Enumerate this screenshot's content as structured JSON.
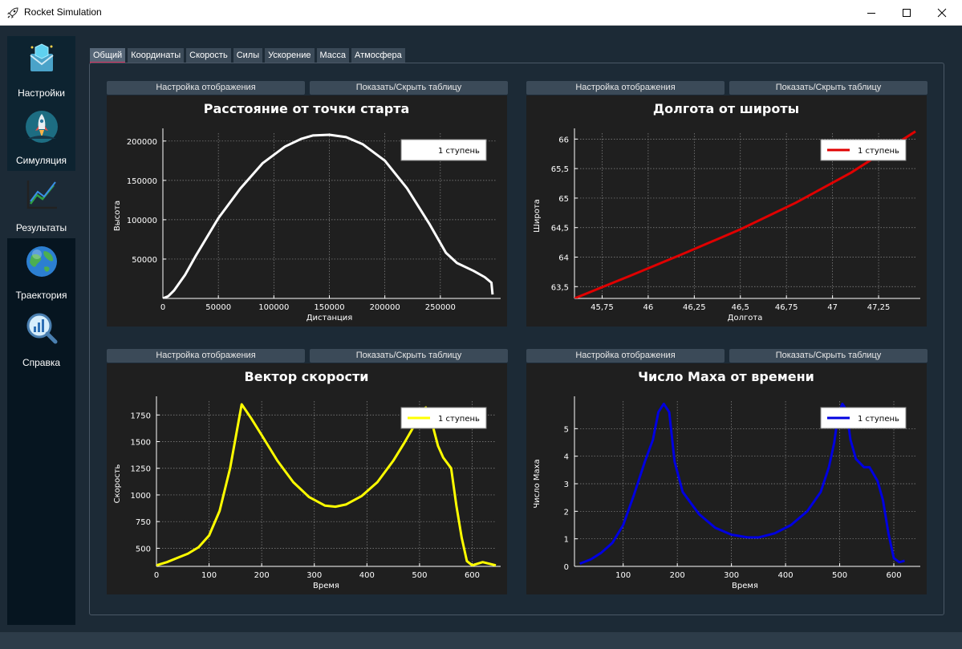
{
  "window": {
    "title": "Rocket Simulation",
    "icon": "rocket-icon"
  },
  "sidebar": {
    "items": [
      {
        "label": "Настройки",
        "icon": "settings-envelope-icon"
      },
      {
        "label": "Симуляция",
        "icon": "rocket-launch-icon"
      },
      {
        "label": "Результаты",
        "icon": "line-chart-icon"
      },
      {
        "label": "Траектория",
        "icon": "globe-icon"
      },
      {
        "label": "Справка",
        "icon": "magnifier-chart-icon"
      }
    ]
  },
  "tabs": [
    "Общий",
    "Координаты",
    "Скорость",
    "Силы",
    "Ускорение",
    "Масса",
    "Атмосфера"
  ],
  "buttons": {
    "display_settings": "Настройка отображения",
    "toggle_table": "Показать/Скрыть таблицу"
  },
  "chart_data": [
    {
      "type": "line",
      "title": "Расстояние от точки старта",
      "xlabel": "Дистанция",
      "ylabel": "Высота",
      "xlim": [
        0,
        300000
      ],
      "ylim": [
        0,
        210000
      ],
      "xticks": [
        0,
        50000,
        100000,
        150000,
        200000,
        250000
      ],
      "xtick_labels": [
        "0",
        "50000",
        "100000",
        "150000",
        "200000",
        "250000"
      ],
      "yticks": [
        50000,
        100000,
        150000,
        200000
      ],
      "ytick_labels": [
        "50000",
        "100000",
        "150000",
        "200000"
      ],
      "legend_position": "top-right",
      "grid": true,
      "series": [
        {
          "name": "1 ступень",
          "color": "#ffffff",
          "x": [
            0,
            5000,
            10000,
            20000,
            30000,
            50000,
            70000,
            90000,
            110000,
            125000,
            135000,
            150000,
            165000,
            180000,
            200000,
            220000,
            240000,
            255000,
            265000,
            280000,
            290000,
            296000,
            297000
          ],
          "y": [
            0,
            3000,
            10000,
            30000,
            55000,
            102000,
            140000,
            172000,
            193000,
            203000,
            207000,
            208000,
            205000,
            196000,
            175000,
            140000,
            95000,
            58000,
            45000,
            35000,
            27000,
            20000,
            5000
          ]
        }
      ]
    },
    {
      "type": "line",
      "title": "Долгота от широты",
      "xlabel": "Долгота",
      "ylabel": "Широта",
      "xlim": [
        45.6,
        47.45
      ],
      "ylim": [
        63.3,
        66.1
      ],
      "xticks": [
        45.75,
        46,
        46.25,
        46.5,
        46.75,
        47,
        47.25
      ],
      "xtick_labels": [
        "45,75",
        "46",
        "46,25",
        "46,5",
        "46,75",
        "47",
        "47,25"
      ],
      "yticks": [
        63.5,
        64,
        64.5,
        65,
        65.5,
        66
      ],
      "ytick_labels": [
        "63,5",
        "64",
        "64,5",
        "65",
        "65,5",
        "66"
      ],
      "legend_position": "top-right",
      "grid": true,
      "series": [
        {
          "name": "1 ступень",
          "color": "#e00000",
          "x": [
            45.6,
            45.9,
            46.2,
            46.5,
            46.8,
            47.1,
            47.45
          ],
          "y": [
            63.3,
            63.68,
            64.07,
            64.47,
            64.92,
            65.43,
            66.13
          ]
        }
      ]
    },
    {
      "type": "line",
      "title": "Вектор скорости",
      "xlabel": "Время",
      "ylabel": "Скорость",
      "xlim": [
        0,
        645
      ],
      "ylim": [
        330,
        1880
      ],
      "xticks": [
        0,
        100,
        200,
        300,
        400,
        500,
        600
      ],
      "xtick_labels": [
        "0",
        "100",
        "200",
        "300",
        "400",
        "500",
        "600"
      ],
      "yticks": [
        500,
        750,
        1000,
        1250,
        1500,
        1750
      ],
      "ytick_labels": [
        "500",
        "750",
        "1000",
        "1250",
        "1500",
        "1750"
      ],
      "legend_position": "top-right",
      "grid": true,
      "series": [
        {
          "name": "1 ступень",
          "color": "#ffff00",
          "x": [
            0,
            20,
            40,
            60,
            80,
            100,
            120,
            140,
            162,
            180,
            200,
            230,
            260,
            290,
            320,
            340,
            360,
            390,
            420,
            450,
            470,
            490,
            505,
            512,
            518,
            525,
            535,
            545,
            560,
            570,
            580,
            590,
            600,
            620,
            645
          ],
          "y": [
            340,
            370,
            410,
            450,
            510,
            620,
            850,
            1250,
            1850,
            1720,
            1560,
            1320,
            1120,
            980,
            900,
            890,
            910,
            990,
            1120,
            1320,
            1480,
            1650,
            1800,
            1820,
            1760,
            1650,
            1460,
            1350,
            1250,
            900,
            600,
            380,
            340,
            370,
            340
          ]
        }
      ]
    },
    {
      "type": "line",
      "title": "Число Маха от времени",
      "xlabel": "Время",
      "ylabel": "Число Маха",
      "xlim": [
        10,
        640
      ],
      "ylim": [
        0,
        6
      ],
      "xticks": [
        100,
        200,
        300,
        400,
        500,
        600
      ],
      "xtick_labels": [
        "100",
        "200",
        "300",
        "400",
        "500",
        "600"
      ],
      "yticks": [
        0,
        1,
        2,
        3,
        4,
        5
      ],
      "ytick_labels": [
        "0",
        "1",
        "2",
        "3",
        "4",
        "5"
      ],
      "legend_position": "top-right",
      "grid": true,
      "series": [
        {
          "name": "1 ступень",
          "color": "#0000e0",
          "x": [
            20,
            40,
            60,
            80,
            100,
            120,
            140,
            155,
            165,
            175,
            185,
            195,
            210,
            240,
            270,
            300,
            330,
            350,
            380,
            410,
            440,
            465,
            480,
            490,
            497,
            505,
            512,
            520,
            530,
            545,
            555,
            570,
            580,
            590,
            600,
            610,
            620
          ],
          "y": [
            0.1,
            0.25,
            0.5,
            0.85,
            1.5,
            2.6,
            3.8,
            4.6,
            5.6,
            5.9,
            5.6,
            3.8,
            2.7,
            1.9,
            1.4,
            1.15,
            1.05,
            1.05,
            1.2,
            1.5,
            2.0,
            2.7,
            3.6,
            4.5,
            5.5,
            5.9,
            5.7,
            4.6,
            3.9,
            3.6,
            3.6,
            3.1,
            2.4,
            1.2,
            0.3,
            0.15,
            0.2
          ]
        }
      ]
    }
  ]
}
